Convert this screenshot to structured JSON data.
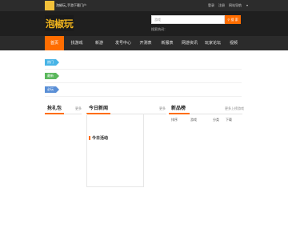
{
  "topbar": {
    "slogan": "泡椒玩_手游下载门户",
    "links": [
      "登录",
      "注册"
    ],
    "nav_dropdown": "网站导航",
    "dropdown_icon": "caret-down-icon"
  },
  "header": {
    "logo_text": "泡椒玩",
    "search": {
      "placeholder": "游戏",
      "button_label": "搜 索",
      "button_icon": "search-icon"
    },
    "hot_search_label": "搜索热词："
  },
  "nav": {
    "items": [
      "首页",
      "找游戏",
      "新游",
      "发号中心",
      "开测表",
      "新服表",
      "网游资讯",
      "玩家论坛",
      "视频"
    ],
    "active_index": 0
  },
  "tags": {
    "hot": "热门",
    "new": "最新",
    "must": "必玩"
  },
  "panels": {
    "gift": {
      "title": "抢礼包",
      "more": "更多"
    },
    "news": {
      "title": "今日新闻",
      "more": "更多",
      "activity_title": "今日活动"
    },
    "newlist": {
      "title": "新品榜",
      "more": "更多上榜游戏",
      "columns": [
        "排序",
        "游戏",
        "分类",
        "下载"
      ]
    }
  },
  "colors": {
    "accent": "#ff6d00",
    "header_bg": "#1f1f1f",
    "nav_bg": "#2b2b2b",
    "logo": "#f2b51d"
  }
}
